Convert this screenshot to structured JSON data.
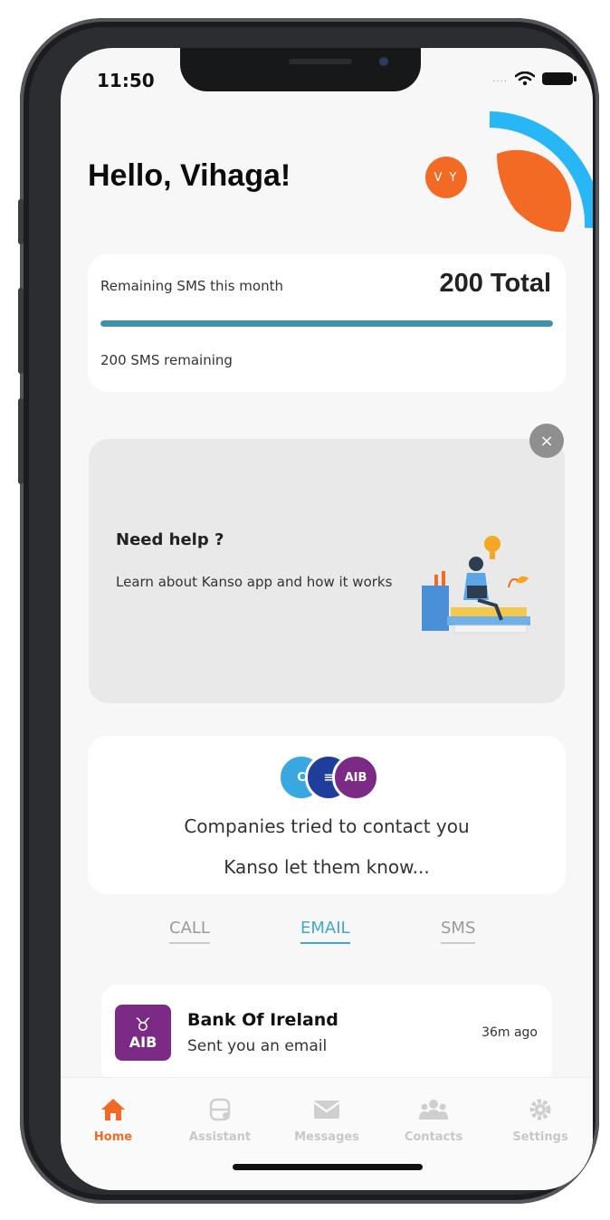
{
  "status_bar": {
    "time": "11:50",
    "signal": "....",
    "wifi_icon": "wifi-icon",
    "battery_icon": "battery-icon"
  },
  "header": {
    "greeting": "Hello, Vihaga!",
    "avatar_initials": "V Y"
  },
  "sms_card": {
    "label": "Remaining SMS this month",
    "total": "200 Total",
    "remaining_text": "200 SMS remaining",
    "progress_fraction": 1.0
  },
  "help_card": {
    "close_symbol": "×",
    "title": "Need help ?",
    "description": "Learn about Kanso app and how it works"
  },
  "companies_card": {
    "logos": [
      "C",
      "≡",
      "AIB"
    ],
    "title": "Companies tried to contact you",
    "subtitle": "Kanso let them know..."
  },
  "tabs": [
    {
      "label": "CALL",
      "active": false
    },
    {
      "label": "EMAIL",
      "active": true
    },
    {
      "label": "SMS",
      "active": false
    }
  ],
  "messages": [
    {
      "logo_text": "AIB",
      "title": "Bank Of Ireland",
      "subtitle": "Sent you an email",
      "time": "36m ago"
    }
  ],
  "bottom_nav": [
    {
      "label": "Home",
      "icon": "home-icon",
      "active": true
    },
    {
      "label": "Assistant",
      "icon": "assistant-icon",
      "active": false
    },
    {
      "label": "Messages",
      "icon": "envelope-icon",
      "active": false
    },
    {
      "label": "Contacts",
      "icon": "contacts-icon",
      "active": false
    },
    {
      "label": "Settings",
      "icon": "gear-icon",
      "active": false
    }
  ],
  "colors": {
    "accent": "#f26a24",
    "progress": "#3e93a8",
    "tab_active": "#43a7c9",
    "aib_purple": "#7b2b86"
  }
}
